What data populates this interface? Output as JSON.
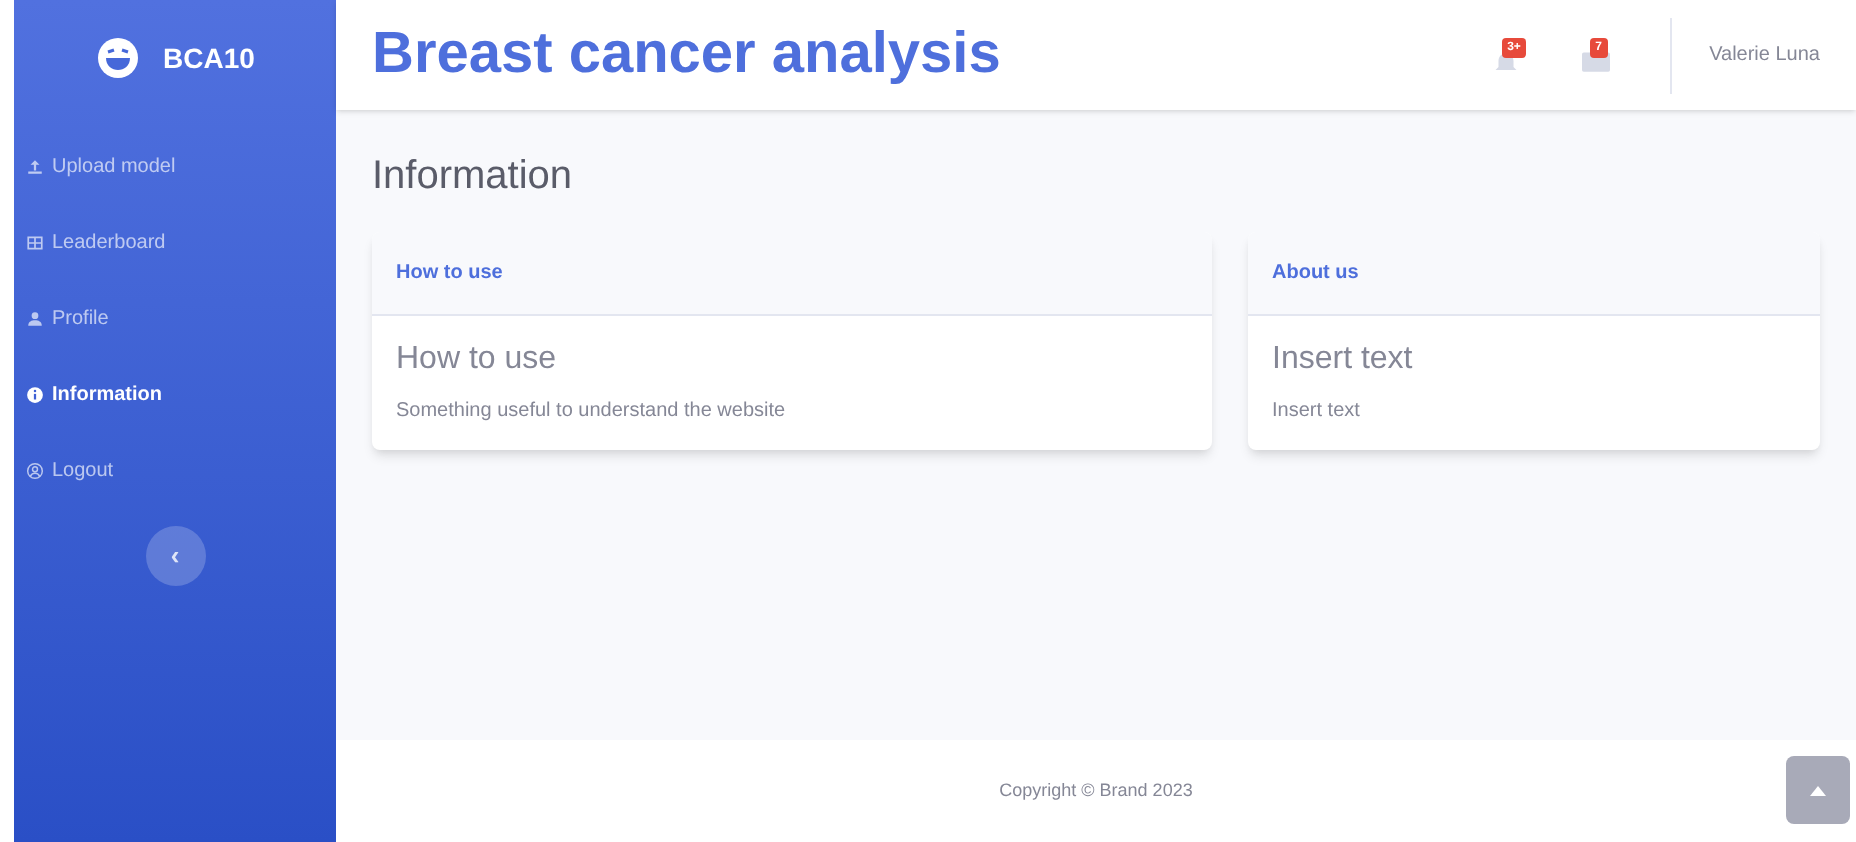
{
  "brand": {
    "name": "BCA10"
  },
  "sidebar": {
    "items": [
      {
        "kind": "upload",
        "label": "Upload model",
        "selected": false
      },
      {
        "kind": "table",
        "label": "Leaderboard",
        "selected": false
      },
      {
        "kind": "user",
        "label": "Profile",
        "selected": false
      },
      {
        "kind": "info",
        "label": "Information",
        "selected": true
      },
      {
        "kind": "logout",
        "label": "Logout",
        "selected": false
      }
    ],
    "toggle": "‹"
  },
  "topbar": {
    "title": "Breast cancer analysis",
    "alerts_badge": "3+",
    "messages_badge": "7",
    "user": "Valerie Luna"
  },
  "page": {
    "heading": "Information",
    "cards": [
      {
        "header": "How to use",
        "title": "How to use",
        "text": "Something useful to understand the website"
      },
      {
        "header": "About us",
        "title": "Insert text",
        "text": "Insert text"
      }
    ]
  },
  "footer": {
    "copyright": "Copyright © Brand 2023"
  }
}
